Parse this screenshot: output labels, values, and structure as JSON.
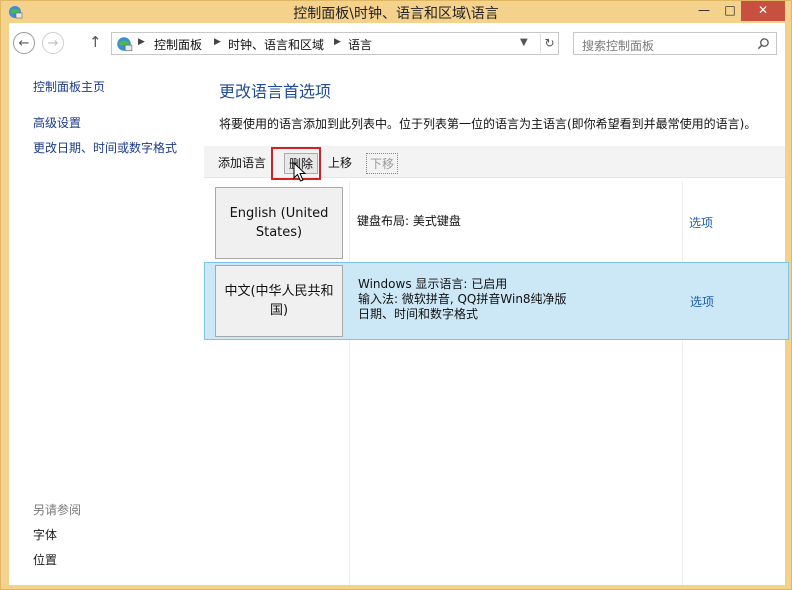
{
  "window": {
    "title": "控制面板\\时钟、语言和区域\\语言",
    "min_label": "—",
    "max_label": "□",
    "close_label": "✕"
  },
  "nav": {
    "breadcrumbs": [
      "控制面板",
      "时钟、语言和区域",
      "语言"
    ],
    "search_placeholder": "搜索控制面板"
  },
  "sidebar": {
    "home": "控制面板主页",
    "advanced": "高级设置",
    "change_date": "更改日期、时间或数字格式",
    "see_also_heading": "另请参阅",
    "fonts": "字体",
    "location": "位置"
  },
  "main": {
    "title": "更改语言首选项",
    "description": "将要使用的语言添加到此列表中。位于列表第一位的语言为主语言(即你希望看到并最常使用的语言)。",
    "toolbar": {
      "add": "添加语言",
      "remove": "删除",
      "move_up": "上移",
      "move_down": "下移"
    },
    "languages": [
      {
        "name": "English (United States)",
        "details": [
          "键盘布局: 美式键盘"
        ],
        "options": "选项"
      },
      {
        "name": "中文(中华人民共和国)",
        "details": [
          "Windows 显示语言: 已启用",
          "输入法: 微软拼音, QQ拼音Win8纯净版",
          "日期、时间和数字格式"
        ],
        "options": "选项"
      }
    ]
  }
}
